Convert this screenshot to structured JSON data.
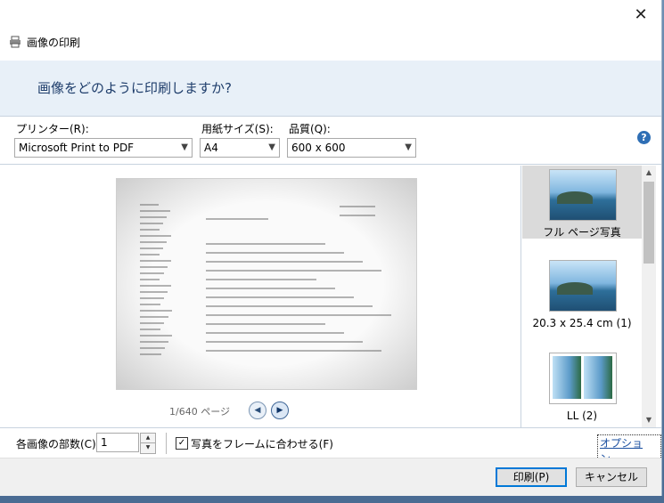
{
  "window": {
    "title": "画像の印刷",
    "close_glyph": "✕"
  },
  "header": {
    "question": "画像をどのように印刷しますか?"
  },
  "settings": {
    "printer": {
      "label": "プリンター(R):",
      "value": "Microsoft Print to PDF"
    },
    "paper_size": {
      "label": "用紙サイズ(S):",
      "value": "A4"
    },
    "quality": {
      "label": "品質(Q):",
      "value": "600 x 600"
    },
    "help_glyph": "?"
  },
  "preview": {
    "page_indicator": "1/640 ページ",
    "prev_glyph": "◀",
    "next_glyph": "▶"
  },
  "layouts": [
    {
      "label": "フル ページ写真",
      "selected": true
    },
    {
      "label": "20.3 x 25.4 cm (1)",
      "selected": false
    },
    {
      "label": "LL (2)",
      "selected": false
    }
  ],
  "scroll": {
    "up_glyph": "▲",
    "down_glyph": "▼"
  },
  "copies": {
    "label": "各画像の部数(C):",
    "value": "1",
    "up_glyph": "▲",
    "down_glyph": "▼"
  },
  "fit_frame": {
    "label": "写真をフレームに合わせる(F)",
    "checked": true,
    "check_glyph": "✓"
  },
  "options_link": "オプション...",
  "buttons": {
    "print": "印刷(P)",
    "cancel": "キャンセル"
  },
  "colors": {
    "accent": "#0078d7",
    "header_band": "#e8f0f8",
    "header_text": "#1e3d6b"
  }
}
